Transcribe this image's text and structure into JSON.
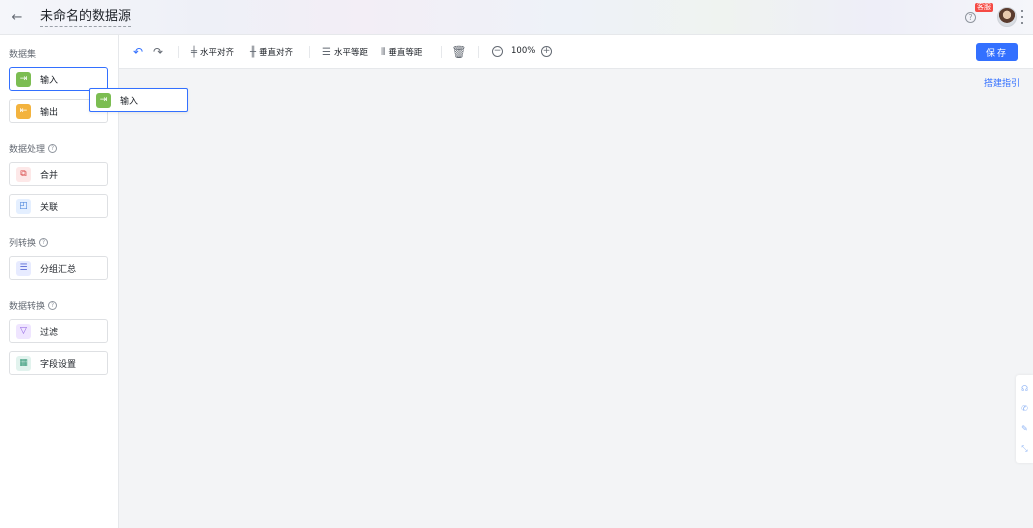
{
  "header": {
    "back_icon": "arrow-left-icon",
    "title": "未命名的数据源",
    "help_glyph": "?",
    "kefu_badge": "客服"
  },
  "sidebar": {
    "sections": [
      {
        "title": "数据集",
        "items": [
          {
            "label": "输入",
            "icon": "input-icon",
            "color": "#7cbd52"
          },
          {
            "label": "输出",
            "icon": "output-icon",
            "color": "#f3b33e"
          }
        ]
      },
      {
        "title": "数据处理",
        "items": [
          {
            "label": "合并",
            "icon": "merge-icon"
          },
          {
            "label": "关联",
            "icon": "join-icon"
          }
        ]
      },
      {
        "title": "列转换",
        "items": [
          {
            "label": "分组汇总",
            "icon": "group-summary-icon"
          }
        ]
      },
      {
        "title": "数据转换",
        "items": [
          {
            "label": "过滤",
            "icon": "filter-icon"
          },
          {
            "label": "字段设置",
            "icon": "field-settings-icon"
          }
        ]
      }
    ],
    "help_glyph": "?"
  },
  "drag_ghost": {
    "label": "输入"
  },
  "toolbar": {
    "undo_icon": "undo-icon",
    "redo_icon": "redo-icon",
    "h_align": "水平对齐",
    "v_align": "垂直对齐",
    "h_distribute": "水平等距",
    "v_distribute": "垂直等距",
    "delete_icon": "trash-icon",
    "zoom_out_glyph": "−",
    "zoom": "100%",
    "zoom_in_glyph": "+",
    "save": "保存"
  },
  "canvas": {
    "guide_link": "搭建指引",
    "float_icons": [
      "headset-icon",
      "phone-icon",
      "edit-icon",
      "collapse-icon"
    ]
  },
  "colors": {
    "accent": "#3370ff",
    "badge": "#f54a45"
  }
}
